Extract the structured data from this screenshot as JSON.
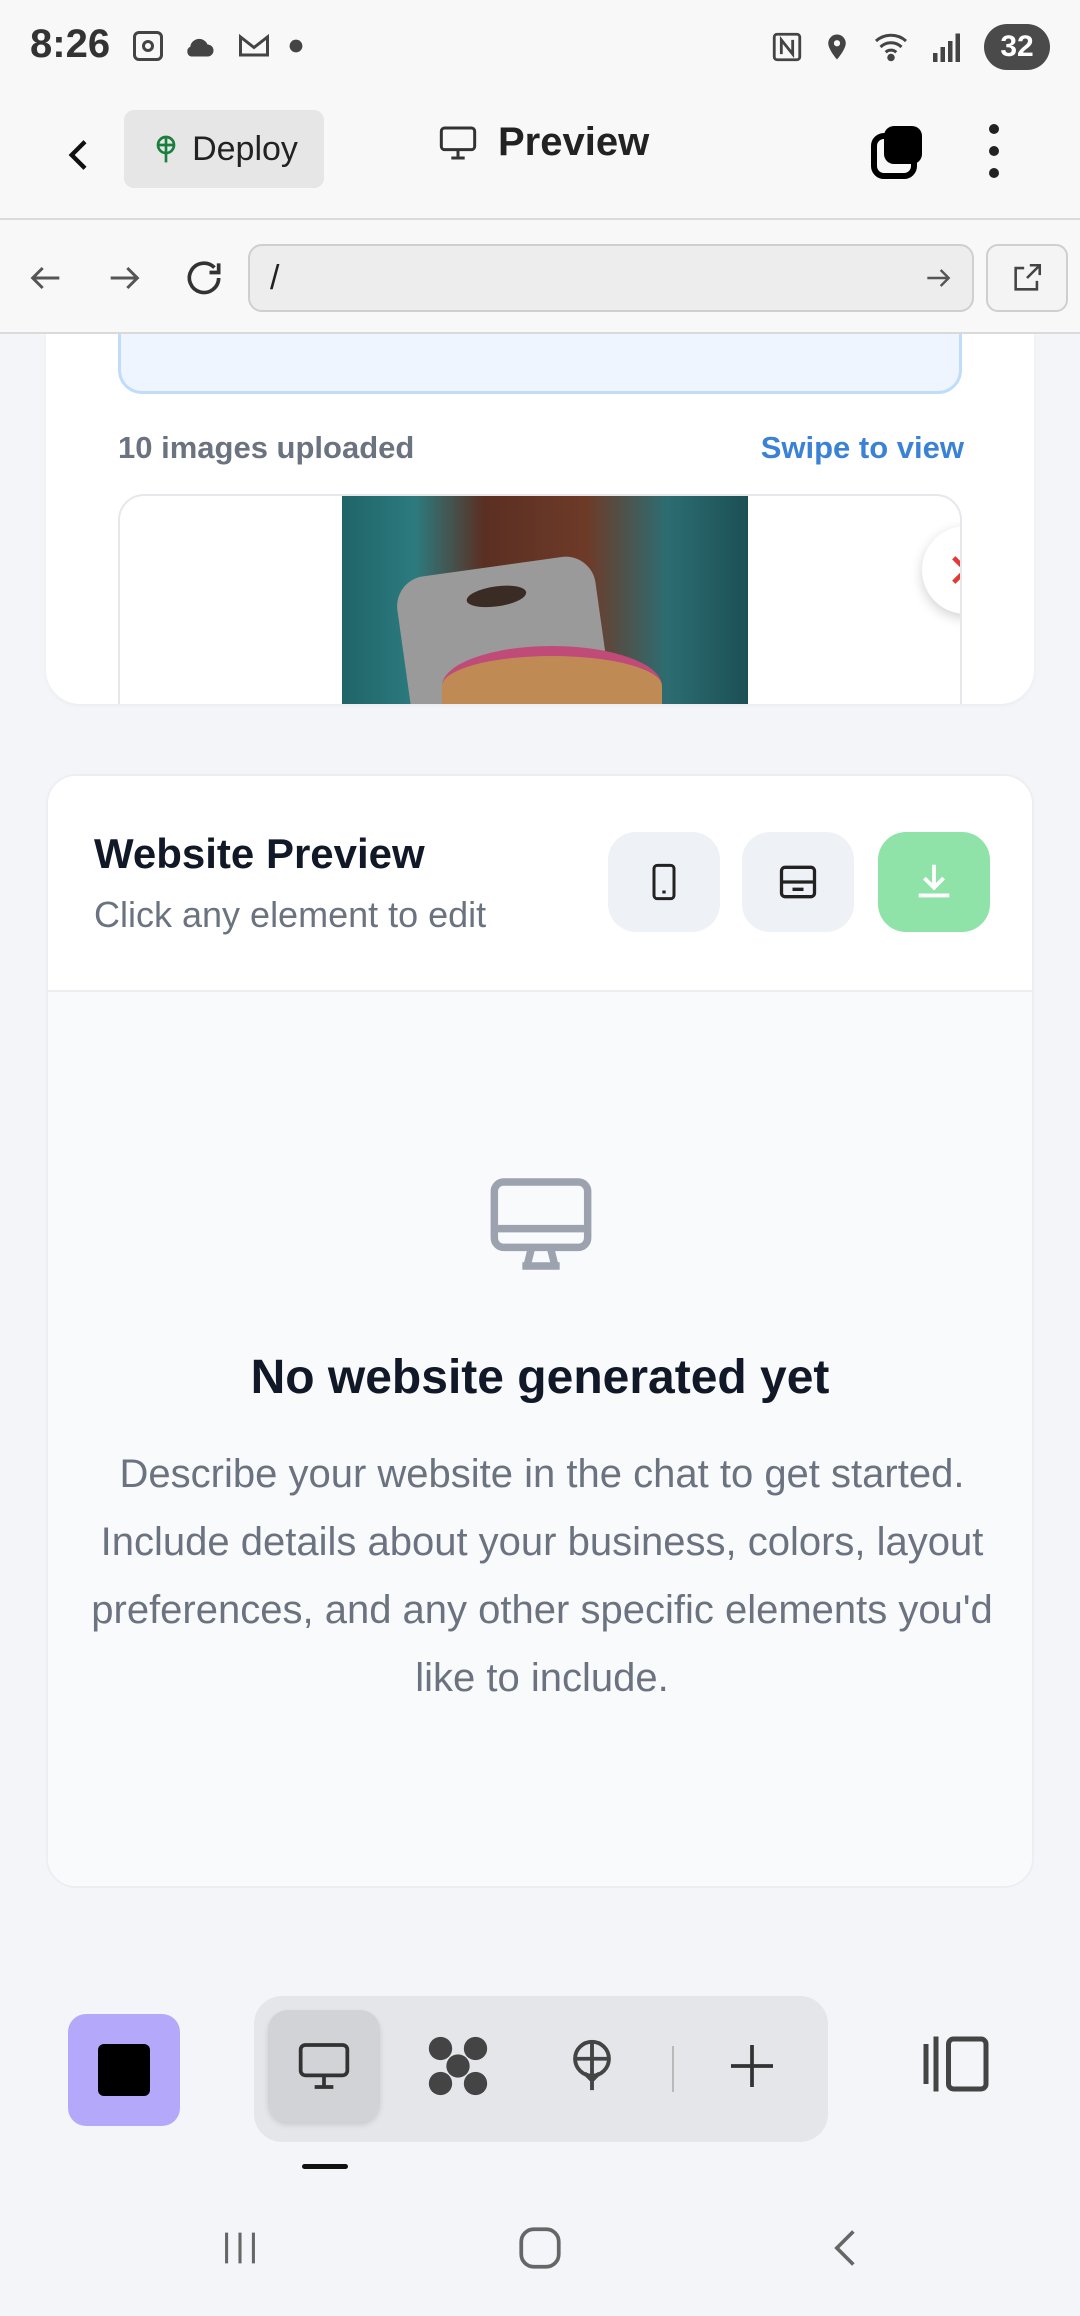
{
  "status_bar": {
    "time": "8:26",
    "battery": "32"
  },
  "header": {
    "back_icon": "chevron-left-icon",
    "deploy_label": "Deploy",
    "title": "Preview"
  },
  "url_bar": {
    "url": "/"
  },
  "upload_section": {
    "count_text": "10 images uploaded",
    "swipe_text": "Swipe to view"
  },
  "website_preview": {
    "heading": "Website Preview",
    "subheading": "Click any element to edit",
    "empty_title": "No website generated yet",
    "empty_description": "Describe your website in the chat to get started. Include details about your business, colors, layout preferences, and any other specific elements you'd like to include."
  },
  "colors": {
    "accent_blue": "#3b82d6",
    "download_green": "#8fe3a8",
    "purple_button": "#b4a8fb",
    "remove_red": "#e53935"
  }
}
